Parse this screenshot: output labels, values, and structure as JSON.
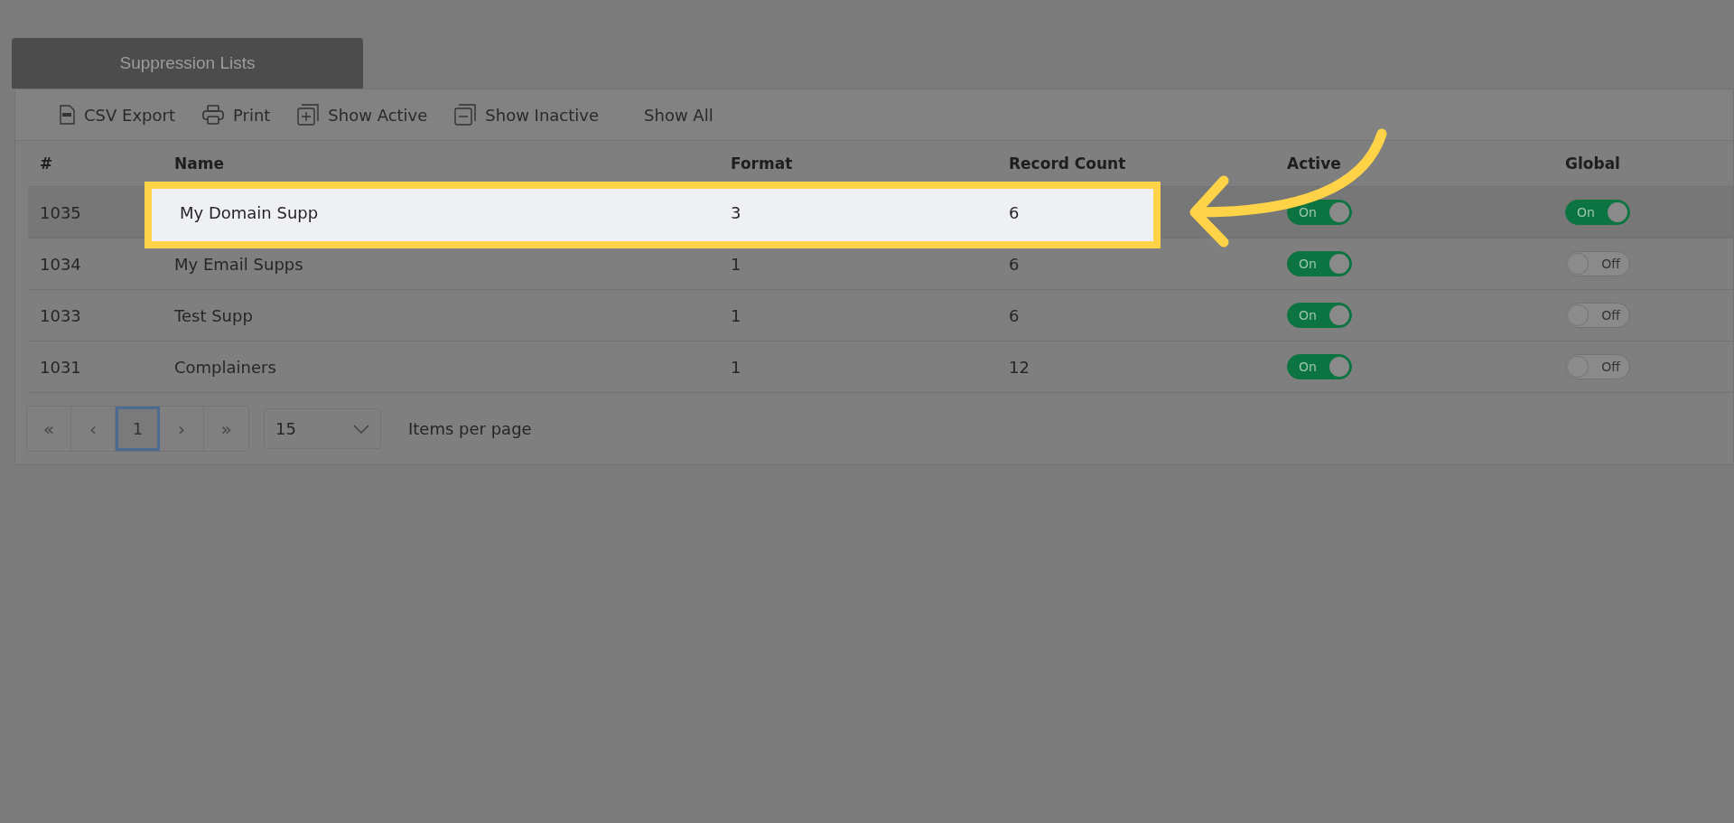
{
  "tabs": [
    {
      "label": "Suppression Lists",
      "selected": true
    }
  ],
  "toolbar": [
    {
      "kind": "csv",
      "label": "CSV Export"
    },
    {
      "kind": "print",
      "label": "Print"
    },
    {
      "kind": "plus",
      "label": "Show Active"
    },
    {
      "kind": "minus",
      "label": "Show Inactive"
    },
    {
      "kind": "none",
      "label": "Show All"
    }
  ],
  "table": {
    "columns": [
      "#",
      "Name",
      "Format",
      "Record Count",
      "Active",
      "Global"
    ],
    "rows": [
      {
        "cells": [
          "1035",
          "My Domain Supp",
          "3",
          "6"
        ],
        "active": {
          "on": true,
          "label": "On"
        },
        "global": {
          "on": true,
          "label": "On"
        },
        "selected": true,
        "highlighted": true
      },
      {
        "cells": [
          "1034",
          "My Email Supps",
          "1",
          "6"
        ],
        "active": {
          "on": true,
          "label": "On"
        },
        "global": {
          "on": false,
          "label": "Off"
        },
        "selected": false,
        "highlighted": false
      },
      {
        "cells": [
          "1033",
          "Test Supp",
          "1",
          "6"
        ],
        "active": {
          "on": true,
          "label": "On"
        },
        "global": {
          "on": false,
          "label": "Off"
        },
        "selected": false,
        "highlighted": false
      },
      {
        "cells": [
          "1031",
          "Complainers",
          "1",
          "12"
        ],
        "active": {
          "on": true,
          "label": "On"
        },
        "global": {
          "on": false,
          "label": "Off"
        },
        "selected": false,
        "highlighted": false
      }
    ]
  },
  "pager": {
    "buttons": [
      {
        "label": "«",
        "kind": "nav",
        "disabled": true
      },
      {
        "label": "‹",
        "kind": "nav",
        "disabled": true
      },
      {
        "label": "1",
        "kind": "page",
        "selected": true
      },
      {
        "label": "›",
        "kind": "nav",
        "disabled": true
      },
      {
        "label": "»",
        "kind": "nav",
        "disabled": true
      }
    ],
    "page_size": "15",
    "page_size_label": "Items per page"
  }
}
